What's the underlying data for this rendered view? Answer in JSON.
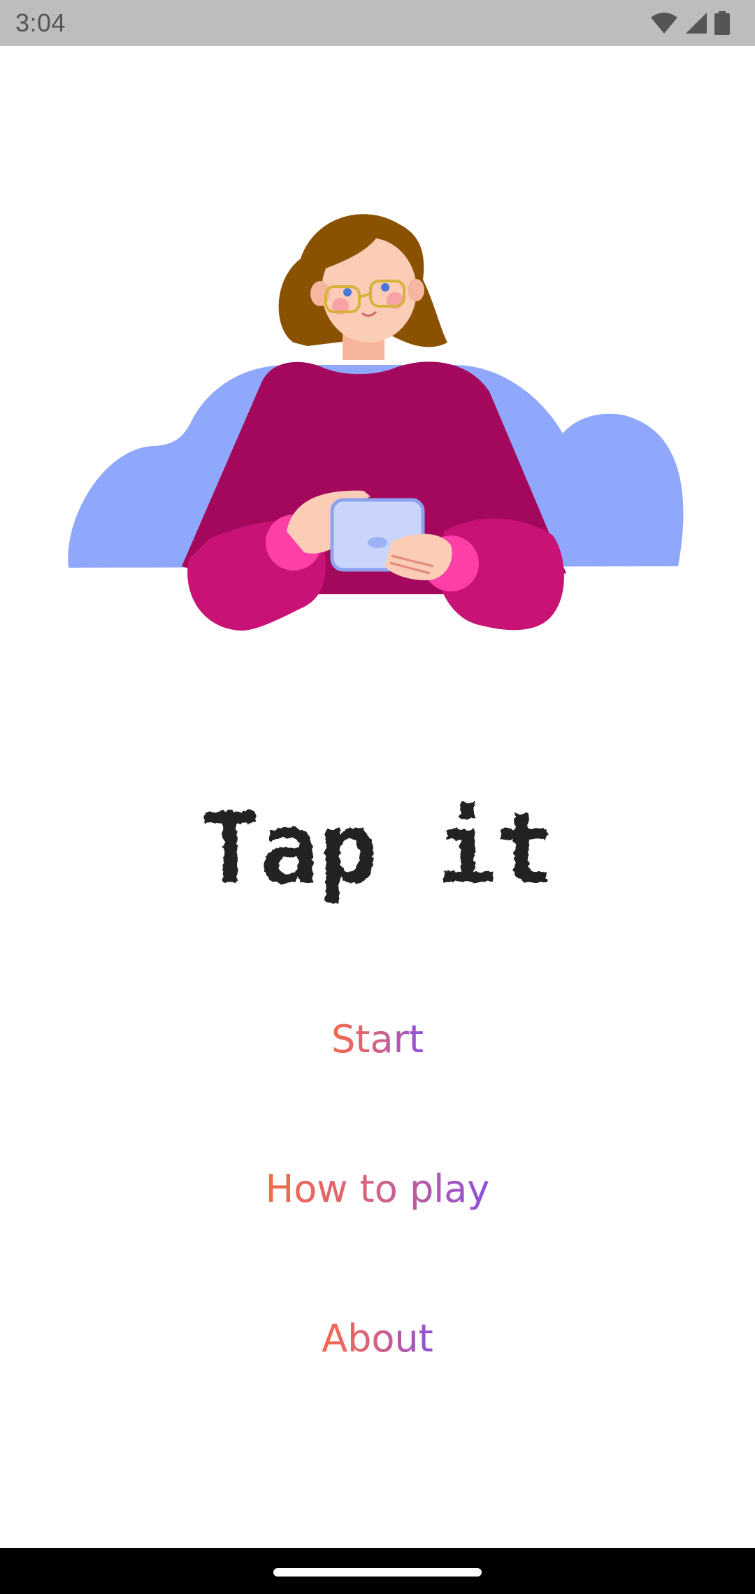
{
  "status_bar": {
    "time": "3:04",
    "icons": [
      "wifi-icon",
      "cellular-signal-icon",
      "battery-icon"
    ]
  },
  "illustration": {
    "subject": "woman-with-glasses-holding-phone"
  },
  "app": {
    "logo_text": "Tap it"
  },
  "menu": {
    "start_label": "Start",
    "how_to_play_label": "How to play",
    "about_label": "About"
  },
  "colors": {
    "status_bar_bg": "#bdbdbd",
    "menu_gradient_start": "#f46b4c",
    "menu_gradient_end": "#8c4fe0",
    "cloud": "#90a8fc",
    "sweater": "#a3085c",
    "sleeves": "#c81276",
    "hair": "#8a5200",
    "logo": "#222222"
  }
}
